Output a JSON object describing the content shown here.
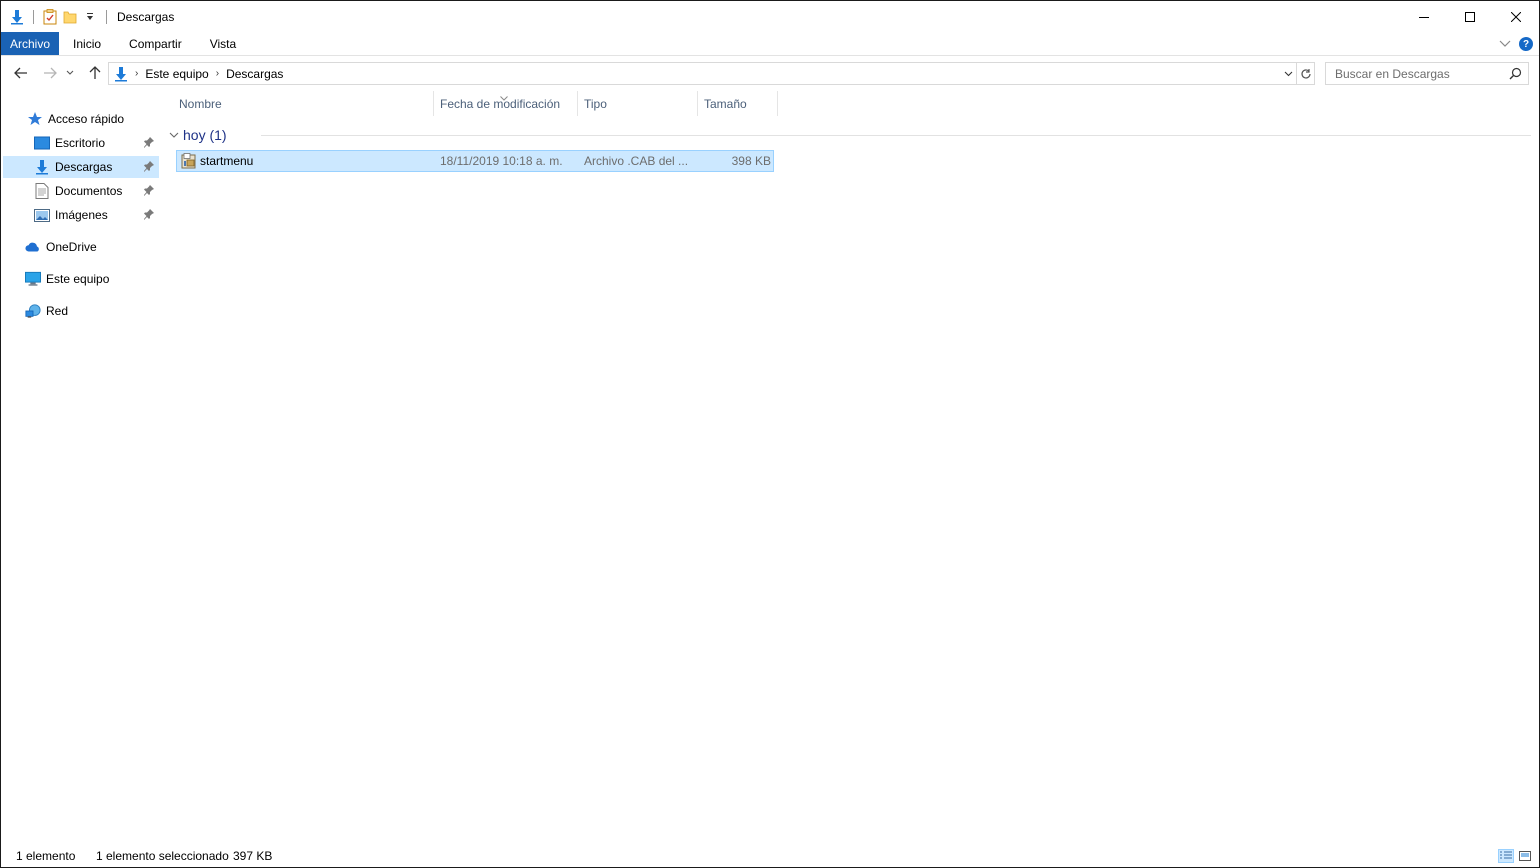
{
  "window": {
    "title": "Descargas",
    "controls": {
      "minimize": "—",
      "maximize": "☐",
      "close": "✕"
    }
  },
  "ribbon": {
    "tabs": [
      {
        "label": "Archivo",
        "active": true
      },
      {
        "label": "Inicio"
      },
      {
        "label": "Compartir"
      },
      {
        "label": "Vista"
      }
    ],
    "help": "?"
  },
  "navigation": {
    "breadcrumbs": [
      "Este equipo",
      "Descargas"
    ],
    "separator": "›",
    "search_placeholder": "Buscar en Descargas"
  },
  "sidebar": {
    "items": [
      {
        "label": "Acceso rápido",
        "icon": "star-icon"
      },
      {
        "label": "Escritorio",
        "icon": "desktop-icon",
        "pinned": true
      },
      {
        "label": "Descargas",
        "icon": "download-arrow-icon",
        "pinned": true,
        "selected": true
      },
      {
        "label": "Documentos",
        "icon": "document-icon",
        "pinned": true
      },
      {
        "label": "Imágenes",
        "icon": "pictures-icon",
        "pinned": true
      },
      {
        "label": "OneDrive",
        "icon": "cloud-icon"
      },
      {
        "label": "Este equipo",
        "icon": "computer-icon"
      },
      {
        "label": "Red",
        "icon": "network-icon"
      }
    ]
  },
  "file_list": {
    "columns": [
      "Nombre",
      "Fecha de modificación",
      "Tipo",
      "Tamaño"
    ],
    "groups": [
      {
        "label": "hoy (1)",
        "rows": [
          {
            "name": "startmenu",
            "modified": "18/11/2019 10:18 a. m.",
            "type": "Archivo .CAB del ...",
            "size": "398 KB",
            "selected": true
          }
        ]
      }
    ]
  },
  "status": {
    "count": "1 elemento",
    "selection": "1 elemento seleccionado",
    "selection_size": "397 KB"
  },
  "colors": {
    "accent": "#1a62b4",
    "selection": "#cce8ff",
    "selection_border": "#99d1ff",
    "group_header": "#1e3287",
    "column_header": "#4c607a"
  }
}
